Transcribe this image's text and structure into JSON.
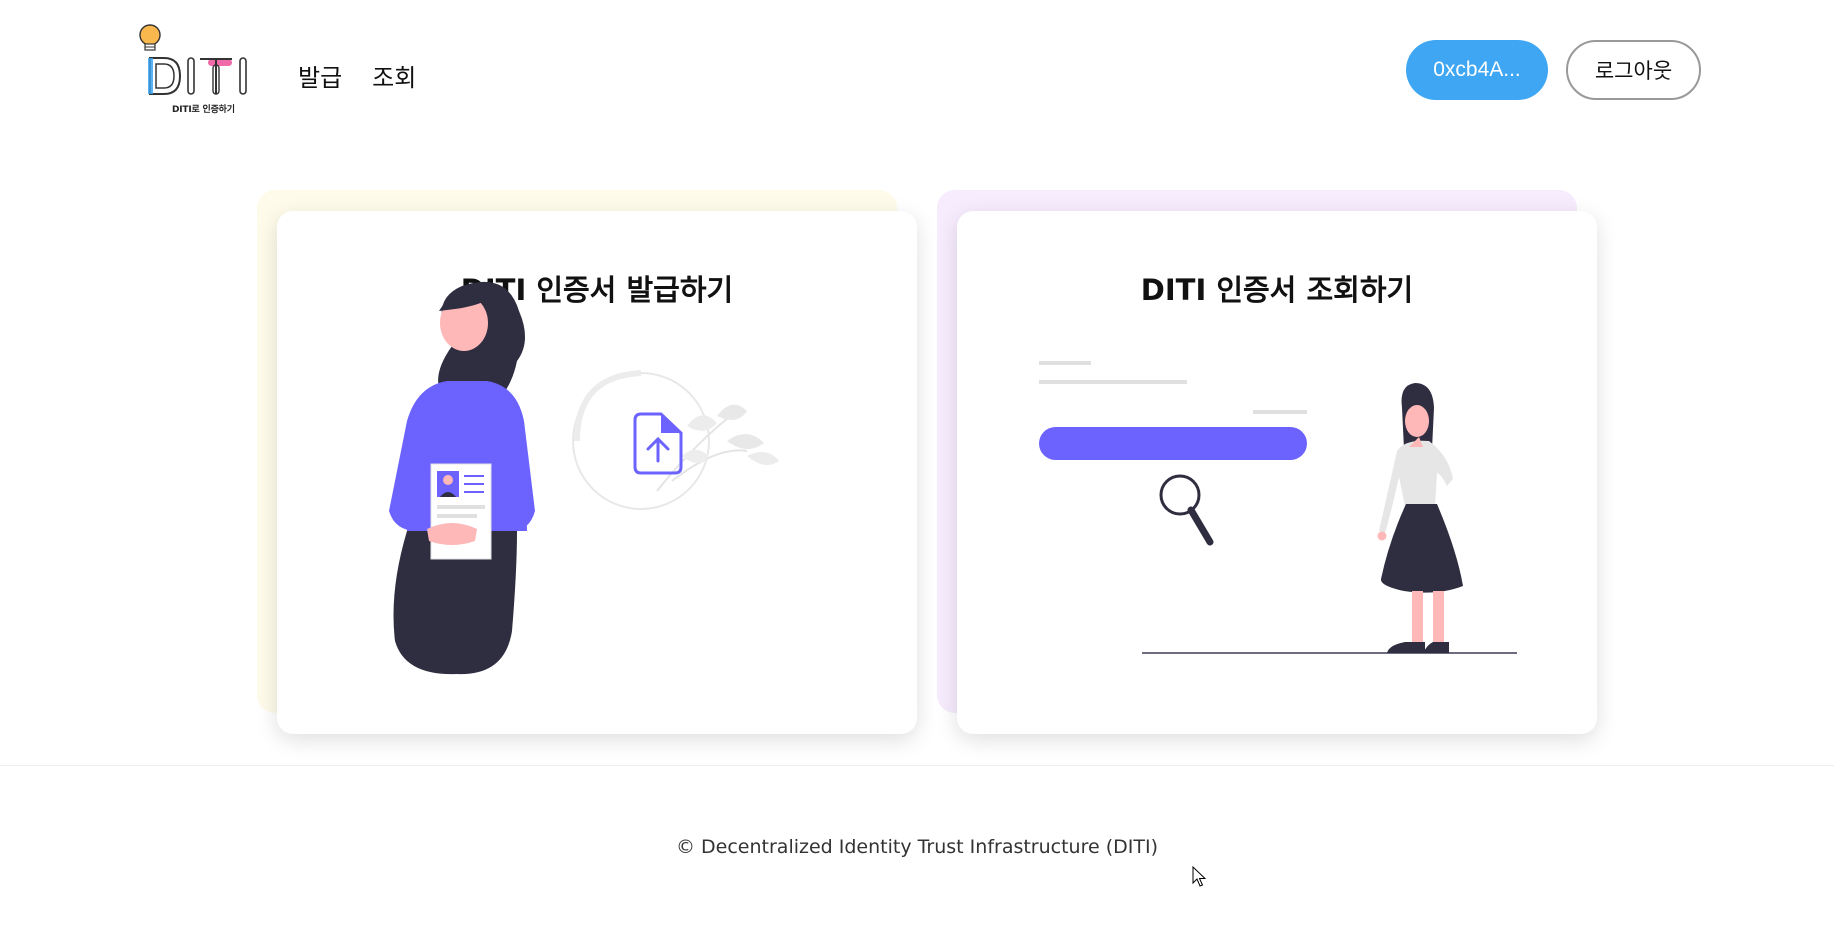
{
  "header": {
    "logo_text": "DITI",
    "logo_subtitle": "DITI로 인증하기",
    "nav": [
      {
        "label": "발급"
      },
      {
        "label": "조회"
      }
    ],
    "wallet_address": "0xcb4A...",
    "logout_label": "로그아웃"
  },
  "cards": [
    {
      "title": "DITI 인증서 발급하기"
    },
    {
      "title": "DITI 인증서 조회하기"
    }
  ],
  "footer": {
    "copyright": "© Decentralized Identity Trust Infrastructure (DITI)"
  },
  "colors": {
    "wallet_button": "#3ea6f2",
    "illustration_accent": "#6c63ff",
    "illustration_dark": "#2f2e41",
    "card_issue_back": "#fffbeb",
    "card_view_back": "#f6ecfd"
  }
}
